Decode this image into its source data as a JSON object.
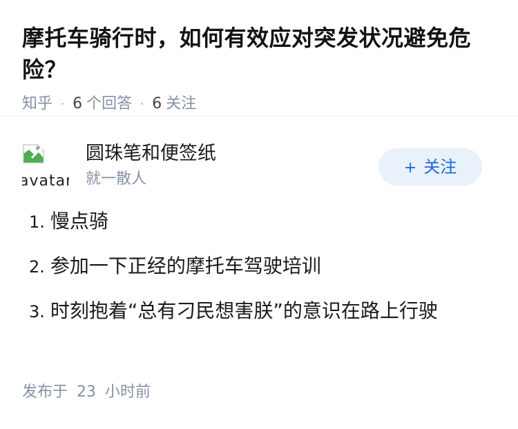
{
  "question": {
    "title": "摩托车骑行时，如何有效应对突发状况避免危险？",
    "source": "知乎",
    "answers_count": "6",
    "answers_label": "个回答",
    "followers_count": "6",
    "followers_label": "关注"
  },
  "author": {
    "avatar_alt": "avatar",
    "name": "圆珠笔和便签纸",
    "bio": "就一散人",
    "follow_plus": "+",
    "follow_label": "关注"
  },
  "answer": {
    "items": [
      {
        "index": "1.",
        "text": "慢点骑"
      },
      {
        "index": "2.",
        "text": "参加一下正经的摩托车驾驶培训"
      },
      {
        "index": "3.",
        "text": "时刻抱着“总有刁民想害朕”的意识在路上行驶"
      }
    ]
  },
  "footer": {
    "prefix": "发布于",
    "hours": "23",
    "suffix": "小时前"
  },
  "colors": {
    "accent": "#1769e6",
    "button_bg": "#e9f1fb",
    "meta_gray": "#8590a6"
  }
}
